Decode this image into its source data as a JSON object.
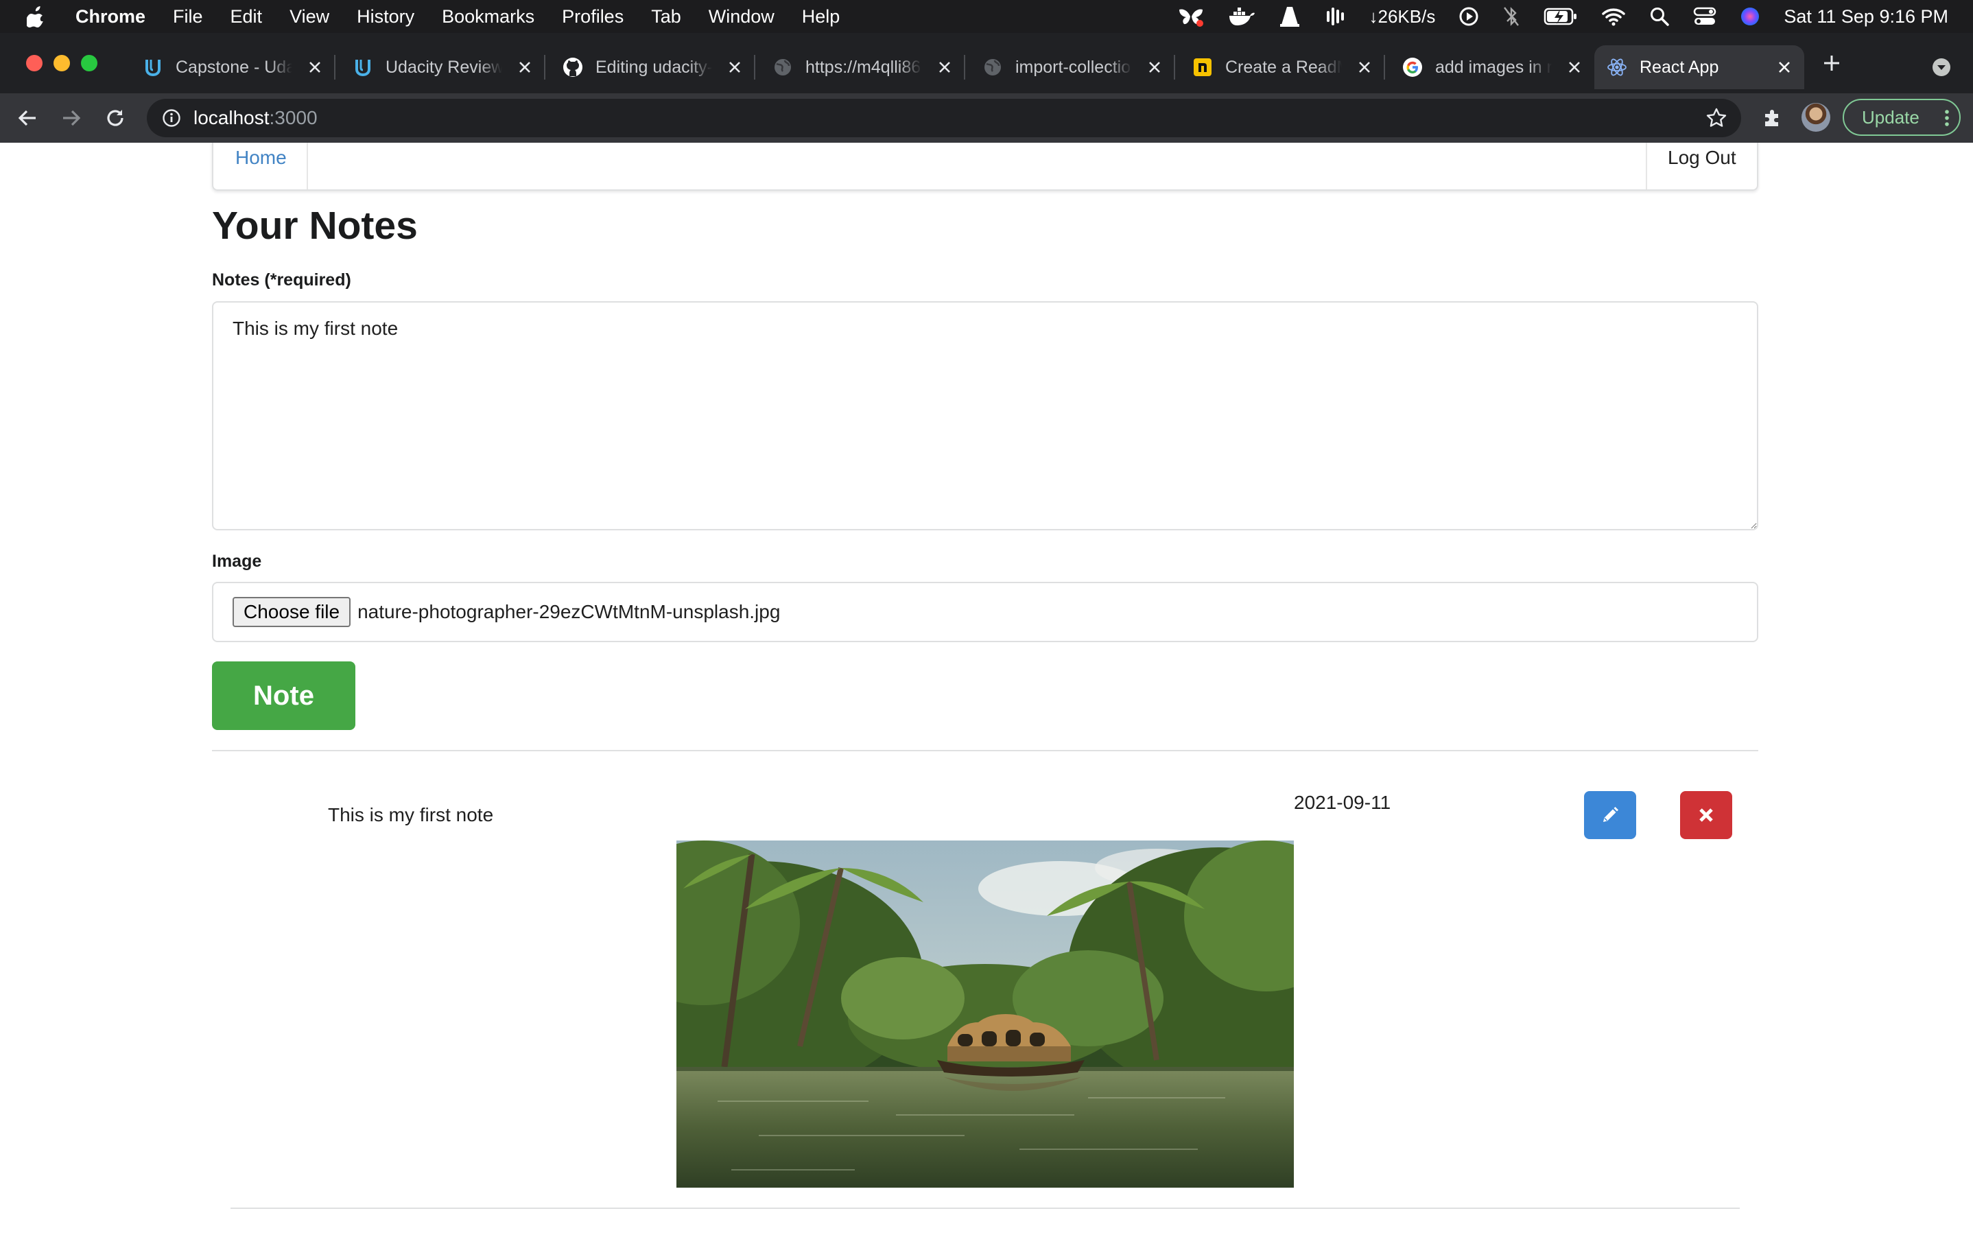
{
  "menubar": {
    "app_name": "Chrome",
    "menus": [
      "File",
      "Edit",
      "View",
      "History",
      "Bookmarks",
      "Profiles",
      "Tab",
      "Window",
      "Help"
    ],
    "network_speed": "↓26KB/s",
    "clock": "Sat 11 Sep  9:16 PM"
  },
  "tabs": [
    {
      "title": "Capstone - Udacity",
      "favicon": "udacity-icon"
    },
    {
      "title": "Udacity Reviews",
      "favicon": "udacity-icon"
    },
    {
      "title": "Editing udacity-",
      "favicon": "github-icon"
    },
    {
      "title": "https://m4qlli86",
      "favicon": "globe-icon"
    },
    {
      "title": "import-collection",
      "favicon": "globe-icon"
    },
    {
      "title": "Create a ReadMe",
      "favicon": "readme-icon"
    },
    {
      "title": "add images in react",
      "favicon": "google-icon"
    },
    {
      "title": "React App",
      "favicon": "react-icon",
      "active": true
    }
  ],
  "toolbar": {
    "url_host": "localhost",
    "url_port": ":3000",
    "update_label": "Update"
  },
  "nav": {
    "home_label": "Home",
    "logout_label": "Log Out"
  },
  "page": {
    "title": "Your Notes",
    "notes_label": "Notes (*required)",
    "notes_value": "This is my first note",
    "image_label": "Image",
    "choose_file_label": "Choose file",
    "file_name": "nature-photographer-29ezCWtMtnM-unsplash.jpg",
    "note_button_label": "Note"
  },
  "note_item": {
    "text": "This is my first note",
    "date": "2021-09-11",
    "edit_icon": "pencil-icon",
    "delete_icon": "close-icon",
    "image_description": "backwater-houseboat-photo"
  },
  "colors": {
    "note_button": "#45a745",
    "edit_button": "#3c87d7",
    "delete_button": "#cf3236",
    "link": "#4183c4",
    "chrome_dark": "#202124",
    "chrome_toolbar": "#35363a"
  }
}
